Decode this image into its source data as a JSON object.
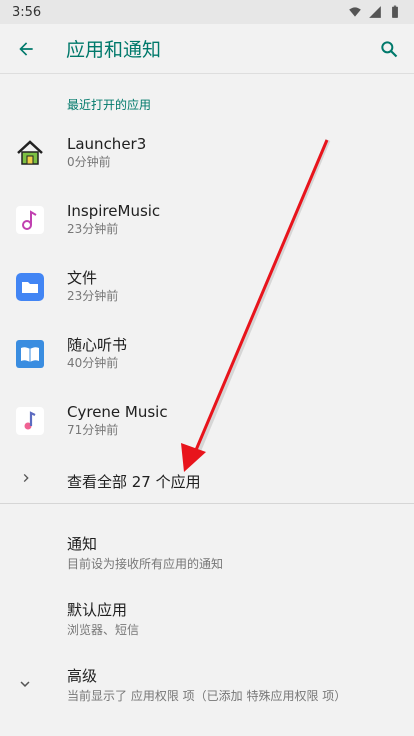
{
  "status_bar": {
    "time": "3:56"
  },
  "app_bar": {
    "title": "应用和通知"
  },
  "recent": {
    "header": "最近打开的应用",
    "apps": [
      {
        "name": "Launcher3",
        "time": "0分钟前",
        "icon": "house-icon"
      },
      {
        "name": "InspireMusic",
        "time": "23分钟前",
        "icon": "music-note-icon"
      },
      {
        "name": "文件",
        "time": "23分钟前",
        "icon": "folder-icon"
      },
      {
        "name": "随心听书",
        "time": "40分钟前",
        "icon": "book-icon"
      },
      {
        "name": "Cyrene Music",
        "time": "71分钟前",
        "icon": "music-note-icon"
      }
    ],
    "see_all": "查看全部 27 个应用"
  },
  "settings": [
    {
      "title": "通知",
      "subtitle": "目前设为接收所有应用的通知"
    },
    {
      "title": "默认应用",
      "subtitle": "浏览器、短信"
    },
    {
      "title": "高级",
      "subtitle": "当前显示了 应用权限 项（已添加 特殊应用权限 项）"
    }
  ],
  "colors": {
    "accent": "#00796b",
    "annotation_arrow": "#e8141c"
  }
}
